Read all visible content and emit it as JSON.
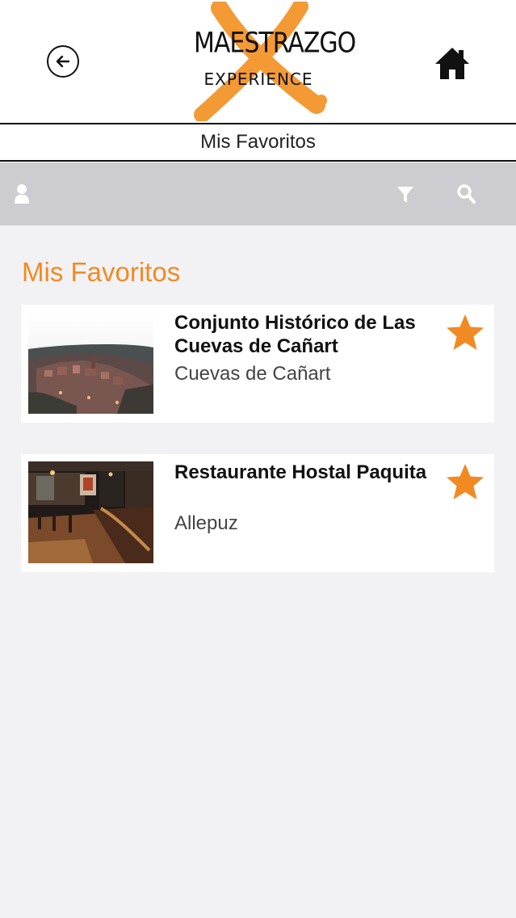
{
  "header": {
    "logo_line1": "MAESTRAZGO",
    "logo_line2": "EXPERIENCE",
    "page_title": "Mis Favoritos"
  },
  "toolbar": {
    "icons": [
      "user-icon",
      "filter-icon",
      "search-icon"
    ]
  },
  "main": {
    "section_title": "Mis Favoritos",
    "favorites": [
      {
        "title": "Conjunto Histórico de Las Cuevas de Cañart",
        "location": "Cuevas de Cañart",
        "favorited": true
      },
      {
        "title": "Restaurante Hostal Paquita",
        "location": "Allepuz",
        "favorited": true
      }
    ]
  },
  "colors": {
    "accent": "#f18a23",
    "toolbar_bg": "#cdcdd1",
    "page_bg": "#f2f2f4"
  }
}
